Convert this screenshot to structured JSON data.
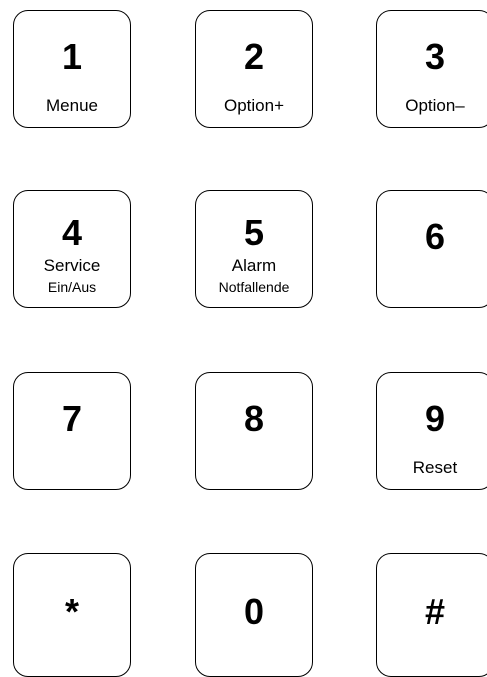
{
  "keypad": {
    "keys": [
      {
        "digit": "1",
        "label": "Menue"
      },
      {
        "digit": "2",
        "label": "Option+"
      },
      {
        "digit": "3",
        "label": "Option–"
      },
      {
        "digit": "4",
        "label": "Service",
        "sublabel": "Ein/Aus"
      },
      {
        "digit": "5",
        "label": "Alarm",
        "sublabel": "Notfallende"
      },
      {
        "digit": "6"
      },
      {
        "digit": "7"
      },
      {
        "digit": "8"
      },
      {
        "digit": "9",
        "label": "Reset"
      },
      {
        "digit": "*"
      },
      {
        "digit": "0"
      },
      {
        "digit": "#"
      }
    ]
  }
}
